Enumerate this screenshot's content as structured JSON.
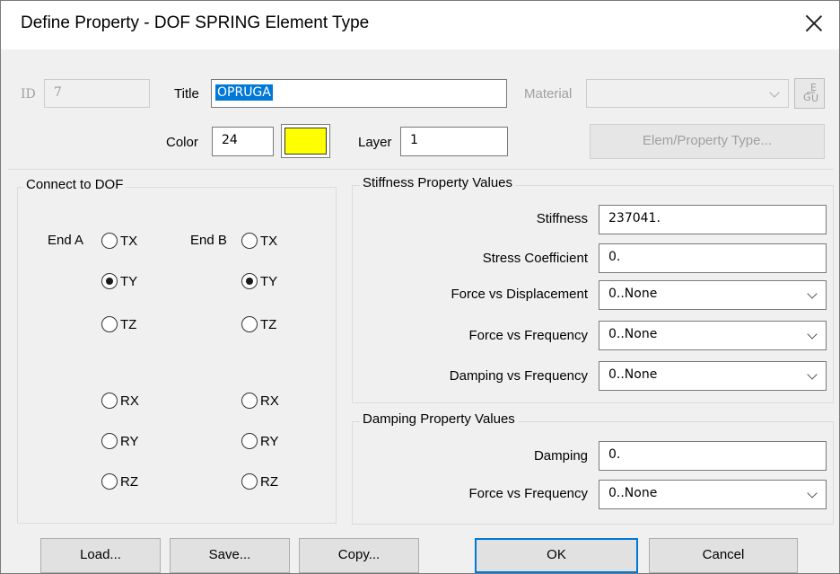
{
  "window": {
    "title": "Define Property - DOF SPRING Element Type"
  },
  "header": {
    "id_label": "ID",
    "id_value": "7",
    "title_label": "Title",
    "title_value": "OPRUGA",
    "material_label": "Material",
    "material_value": "",
    "color_label": "Color",
    "color_value": "24",
    "color_swatch": "#ffff00",
    "layer_label": "Layer",
    "layer_value": "1",
    "elem_type_button": "Elem/Property Type...",
    "egu_icon": "egu-icon"
  },
  "connect": {
    "group_title": "Connect to DOF",
    "end_a_label": "End A",
    "end_b_label": "End B",
    "end_a": [
      {
        "label": "TX",
        "checked": false
      },
      {
        "label": "TY",
        "checked": true
      },
      {
        "label": "TZ",
        "checked": false
      },
      {
        "label": "RX",
        "checked": false
      },
      {
        "label": "RY",
        "checked": false
      },
      {
        "label": "RZ",
        "checked": false
      }
    ],
    "end_b": [
      {
        "label": "TX",
        "checked": false
      },
      {
        "label": "TY",
        "checked": true
      },
      {
        "label": "TZ",
        "checked": false
      },
      {
        "label": "RX",
        "checked": false
      },
      {
        "label": "RY",
        "checked": false
      },
      {
        "label": "RZ",
        "checked": false
      }
    ]
  },
  "stiffness": {
    "group_title": "Stiffness Property Values",
    "stiffness_label": "Stiffness",
    "stiffness_value": "237041.",
    "stress_coef_label": "Stress Coefficient",
    "stress_coef_value": "0.",
    "force_disp_label": "Force vs Displacement",
    "force_disp_value": "0..None",
    "force_freq_label": "Force vs Frequency",
    "force_freq_value": "0..None",
    "damp_freq_label": "Damping vs Frequency",
    "damp_freq_value": "0..None"
  },
  "damping": {
    "group_title": "Damping Property Values",
    "damping_label": "Damping",
    "damping_value": "0.",
    "force_freq_label": "Force vs Frequency",
    "force_freq_value": "0..None"
  },
  "buttons": {
    "load": "Load...",
    "save": "Save...",
    "copy": "Copy...",
    "ok": "OK",
    "cancel": "Cancel"
  },
  "colors": {
    "accent": "#0078d7",
    "swatch_yellow": "#ffff00"
  }
}
